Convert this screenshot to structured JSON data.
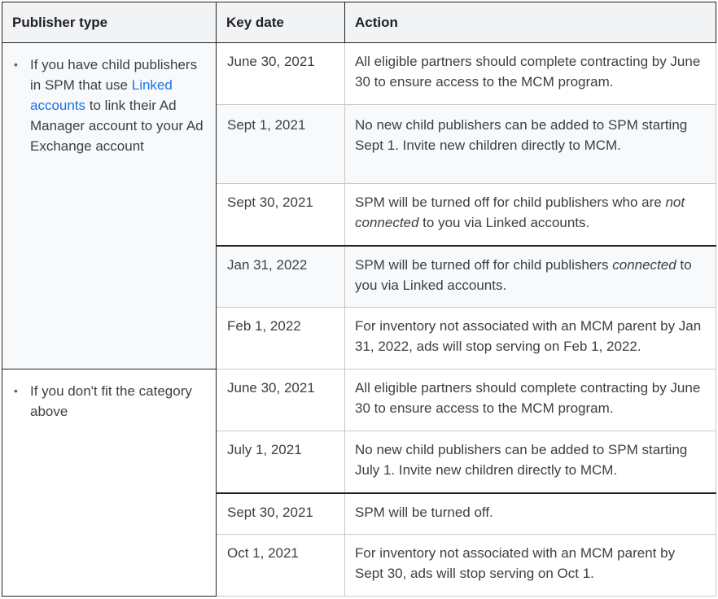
{
  "headers": {
    "publisher_type": "Publisher type",
    "key_date": "Key date",
    "action": "Action"
  },
  "group1": {
    "bullet": "•",
    "text_before_link": "If you have child publishers in SPM that use ",
    "link": "Linked accounts",
    "text_after_link": " to link their Ad Manager account to your Ad Exchange account",
    "rows": [
      {
        "date": "June 30, 2021",
        "action": "All eligible partners should complete contracting by June 30 to ensure access to the MCM program."
      },
      {
        "date": "Sept 1, 2021",
        "action": "No new child publishers can be added to SPM starting Sept 1. Invite new children directly to MCM."
      },
      {
        "date": "Sept 30, 2021",
        "action_pre": "SPM will be turned off for child publishers who are ",
        "action_em": "not connected",
        "action_post": " to you via Linked accounts."
      },
      {
        "date": "Jan 31, 2022",
        "action_pre": "SPM will be turned off for child publishers ",
        "action_em": "connected",
        "action_post": " to you via Linked accounts."
      },
      {
        "date": "Feb 1, 2022",
        "action": "For inventory not associated with an MCM parent by Jan 31, 2022, ads will stop serving on Feb 1, 2022."
      }
    ]
  },
  "group2": {
    "bullet": "•",
    "text": "If you don't fit the category above",
    "rows": [
      {
        "date": "June 30, 2021",
        "action": "All eligible partners should complete contracting by June 30 to ensure access to the MCM program."
      },
      {
        "date": "July 1, 2021",
        "action": "No new child publishers can be added to SPM starting July 1. Invite new children directly to MCM."
      },
      {
        "date": "Sept 30, 2021",
        "action": "SPM will be turned off."
      },
      {
        "date": "Oct 1, 2021",
        "action": "For inventory not associated with an MCM parent by Sept 30, ads will stop serving on Oct 1."
      }
    ]
  }
}
